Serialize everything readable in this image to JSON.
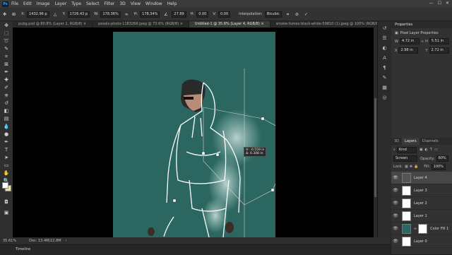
{
  "menubar": {
    "logo": "Ps",
    "items": [
      "File",
      "Edit",
      "Image",
      "Layer",
      "Type",
      "Select",
      "Filter",
      "3D",
      "View",
      "Window",
      "Help"
    ]
  },
  "options": {
    "x_label": "X:",
    "x_value": "1432.96 p",
    "y_label": "Y:",
    "y_value": "1726.43 p",
    "w_label": "W:",
    "w_value": "178.36%",
    "h_label": "H:",
    "h_value": "178.34%",
    "angle_value": "27.89",
    "hskew_label": "H:",
    "hskew_value": "0.00",
    "vskew_label": "V:",
    "vskew_value": "0.00",
    "interp_label": "Interpolation:",
    "interp_value": "Bicubic"
  },
  "tabs": [
    "pubg.psd @ 80.8% (Layer 1, RGB/8)",
    "pexels-photo-1183266.jpeg @ 73.6% (RGB/8)",
    "Untitled-1 @ 35.6% (Layer 4, RGB/8)",
    "smoke-fumes-black-white-59810 (1).jpeg @ 100% (RGB/8)"
  ],
  "active_tab_index": 2,
  "transform_tooltip": {
    "w": "H: -0.559 in",
    "h": "Δ: 0.348 in"
  },
  "status": {
    "zoom": "35.61%",
    "doc": "Doc: 13.4M/22.8M"
  },
  "timeline": {
    "label": "Timeline"
  },
  "properties": {
    "title": "Properties",
    "subtitle": "Pixel Layer Properties",
    "w_label": "W",
    "w_value": "4.72 in",
    "h_label": "H",
    "h_value": "5.51 in",
    "x_label": "X",
    "x_value": "2.98 in",
    "y_label": "Y",
    "y_value": "2.72 in"
  },
  "layers_panel": {
    "tabs": [
      "3D",
      "Layers",
      "Channels"
    ],
    "active_tab": "Layers",
    "filter_label": "Kind",
    "blend_mode": "Screen",
    "opacity_label": "Opacity:",
    "opacity_value": "60%",
    "lock_label": "Lock:",
    "fill_label": "Fill:",
    "fill_value": "100%",
    "layers": [
      {
        "name": "Layer 4",
        "thumb": "dark",
        "selected": true
      },
      {
        "name": "Layer 3",
        "thumb": "white",
        "selected": false
      },
      {
        "name": "Layer 2",
        "thumb": "white",
        "selected": false
      },
      {
        "name": "Layer 1",
        "thumb": "white",
        "selected": false
      },
      {
        "name": "Color Fill 1",
        "thumb": "teal",
        "selected": false
      },
      {
        "name": "Layer 0",
        "thumb": "white",
        "selected": false
      }
    ]
  },
  "colors": {
    "canvas_bg": "#2b6760",
    "accent": "#31a8ff"
  }
}
